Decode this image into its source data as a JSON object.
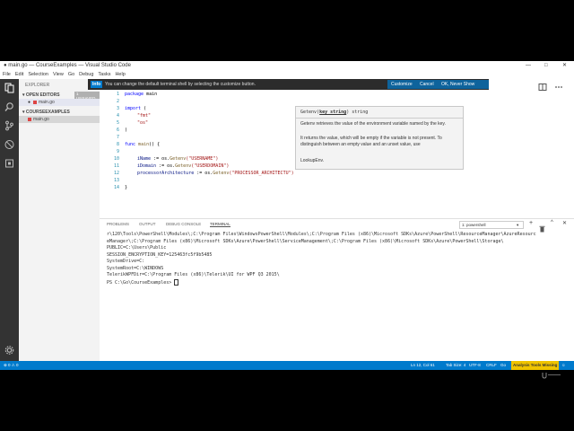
{
  "window": {
    "title": "● main.go — CourseExamples — Visual Studio Code",
    "controls": {
      "minimize": "—",
      "maximize": "□",
      "close": "✕"
    }
  },
  "menu": [
    "File",
    "Edit",
    "Selection",
    "View",
    "Go",
    "Debug",
    "Tasks",
    "Help"
  ],
  "sidebar": {
    "title": "EXPLORER",
    "open_editors": "▾ OPEN EDITORS",
    "unsaved_badge": "1 UNSAVED",
    "open_file": "main.go",
    "folder": "▾ COURSEEXAMPLES",
    "folder_file": "main.go"
  },
  "notification": {
    "badge": "Info",
    "message": "You can change the default terminal shell by selecting the customize button.",
    "customize": "Customize",
    "cancel": "Cancel",
    "never": "OK, Never Show Again"
  },
  "editor": {
    "lines": [
      "1",
      "2",
      "3",
      "4",
      "5",
      "6",
      "7",
      "8",
      "9",
      "10",
      "11",
      "12",
      "13",
      "14"
    ],
    "code": {
      "l1_kw": "package",
      "l1_rest": " main",
      "l3_kw": "import",
      "l3_rest": " (",
      "l4": "\"fmt\"",
      "l5": "\"os\"",
      "l6": ")",
      "l8_kw": "func",
      "l8_fn": " main",
      "l8_rest": "() {",
      "l10_var": "iName",
      "l10_op": " := os.",
      "l10_fn": "Getenv",
      "l10_str": "(\"USERNAME\")",
      "l11_var": "iDomain",
      "l11_op": " := os.",
      "l11_fn": "Getenv",
      "l11_str": "(\"USERDOMAIN\")",
      "l12_var": "processorArchitecture",
      "l12_op": " := os.",
      "l12_fn": "Getenv",
      "l12_str": "(\"PROCESSOR_ARCHITECTU\")",
      "l14": "}"
    }
  },
  "hover": {
    "signature_fn": "Getenv(",
    "signature_param": "key string",
    "signature_rest": ") string",
    "p1": "Getenv retrieves the value of the environment variable named by the key.",
    "p2": "It returns the value, which will be empty if the variable is not present. To distinguish between an empty value and an unset value, use",
    "p3": "LookupEnv."
  },
  "panel": {
    "tabs": [
      "PROBLEMS",
      "OUTPUT",
      "DEBUG CONSOLE",
      "TERMINAL"
    ],
    "shell_select": "1: powershell",
    "terminal": "r\\120\\Tools\\PowerShell\\Modules\\;C:\\Program Files\\WindowsPowerShell\\Modules\\;C:\\Program Files (x86)\\Microsoft SDKs\\Azure\\PowerShell\\ResourceManager\\AzureResourc\neManager\\;C:\\Program Files (x86)\\Microsoft SDKs\\Azure\\PowerShell\\ServiceManagement\\;C:\\Program Files (x86)\\Microsoft SDKs\\Azure\\PowerShell\\Storage\\\nPUBLIC=C:\\Users\\Public\nSESSION_ENCRYPTION_KEY=125463fc5f9b5485\nSystemDrive=C:\nSystemRoot=C:\\WINDOWS\nTelerikWPFDir=C:\\Program Files (x86)\\Telerik\\UI for WPF Q3 2015\\\nPS C:\\Go\\CourseExamples> "
  },
  "statusbar": {
    "errors": "⊗ 0  ⚠ 0",
    "position": "Ln 12, Col 61",
    "tab_size": "Tab Size: 4",
    "encoding": "UTF-8",
    "eol": "CRLF",
    "language": "Go",
    "analysis": "Analysis Tools Missing"
  },
  "colors": {
    "accent": "#007acc",
    "activitybar": "#333333",
    "notification": "#2c2c2c"
  }
}
